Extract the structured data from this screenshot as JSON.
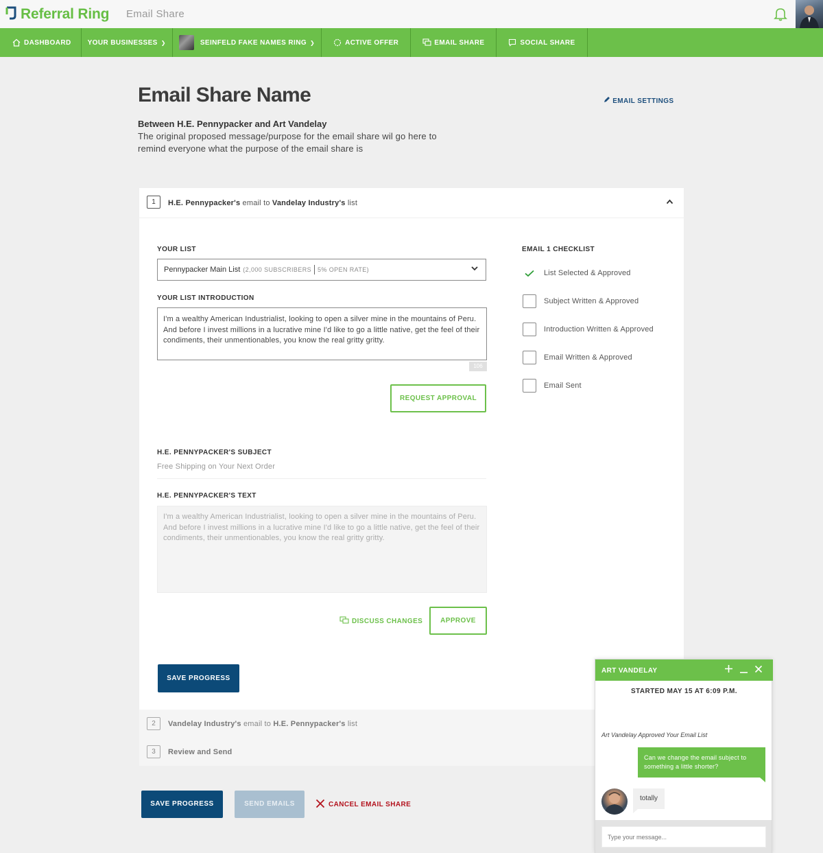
{
  "app": {
    "logo_text": "Referral Ring",
    "page_label": "Email Share"
  },
  "nav": {
    "items": [
      {
        "label": "DASHBOARD"
      },
      {
        "label": "YOUR BUSINESSES"
      },
      {
        "label": "SEINFELD FAKE NAMES RING"
      },
      {
        "label": "ACTIVE OFFER"
      },
      {
        "label": "EMAIL SHARE"
      },
      {
        "label": "SOCIAL SHARE"
      }
    ]
  },
  "header": {
    "title": "Email Share Name",
    "settings_label": "EMAIL SETTINGS",
    "between": "Between H.E. Pennypacker and Art Vandelay",
    "purpose": "The original proposed message/purpose for the email share wil go here to remind everyone what the purpose of the email share is"
  },
  "step1": {
    "number": "1",
    "owner": "H.E. Pennypacker's",
    "email_to": "email to",
    "target": "Vandelay Industry's",
    "list_word": "list",
    "your_list_label": "YOUR LIST",
    "list_name": "Pennypacker Main List",
    "list_subscribers": "(2,000 SUBSCRIBERS",
    "list_open_rate": "5% OPEN RATE)",
    "intro_label": "YOUR LIST INTRODUCTION",
    "intro_text": "I'm a wealthy American Industrialist, looking to open a silver mine in the mountains of Peru. And before I invest millions in a lucrative mine I'd like to go a little native, get the feel of their condiments, their unmentionables, you know the real gritty gritty.",
    "char_count": "106",
    "request_approval": "REQUEST APPROVAL",
    "subject_label": "H.E. PENNYPACKER'S SUBJECT",
    "subject_value": "Free Shipping on Your Next Order",
    "text_label": "H.E. PENNYPACKER'S TEXT",
    "text_value": "I'm a wealthy American Industrialist, looking to open a silver mine in the mountains of Peru. And before I invest millions in a lucrative mine I'd like to go a little native, get the feel of their condiments, their unmentionables, you know the real gritty gritty.",
    "discuss_changes": "DISCUSS CHANGES",
    "approve": "APPROVE",
    "save_progress": "SAVE PROGRESS",
    "checklist_title": "EMAIL 1 CHECKLIST",
    "checklist": [
      {
        "label": "List Selected & Approved",
        "checked": true
      },
      {
        "label": "Subject Written & Approved",
        "checked": false
      },
      {
        "label": "Introduction Written & Approved",
        "checked": false
      },
      {
        "label": "Email Written & Approved",
        "checked": false
      },
      {
        "label": "Email Sent",
        "checked": false
      }
    ]
  },
  "step2": {
    "number": "2",
    "owner": "Vandelay Industry's",
    "email_to": "email to",
    "target": "H.E. Pennypacker's",
    "list_word": "list"
  },
  "step3": {
    "number": "3",
    "label": "Review and Send"
  },
  "actions": {
    "save_progress": "SAVE PROGRESS",
    "send_emails": "SEND EMAILS",
    "cancel": "CANCEL EMAIL SHARE"
  },
  "chat": {
    "name": "ART VANDELAY",
    "started": "STARTED MAY 15 AT 6:09 P.M.",
    "status": "Art Vandelay Approved Your Email List",
    "outgoing": "Can we change the email subject to something a little shorter?",
    "incoming": "totally",
    "placeholder": "Type your message..."
  },
  "colors": {
    "brand_green": "#6cc04a",
    "navy": "#0c4a78",
    "danger": "#b3121d",
    "disabled": "#a9bfd0"
  }
}
